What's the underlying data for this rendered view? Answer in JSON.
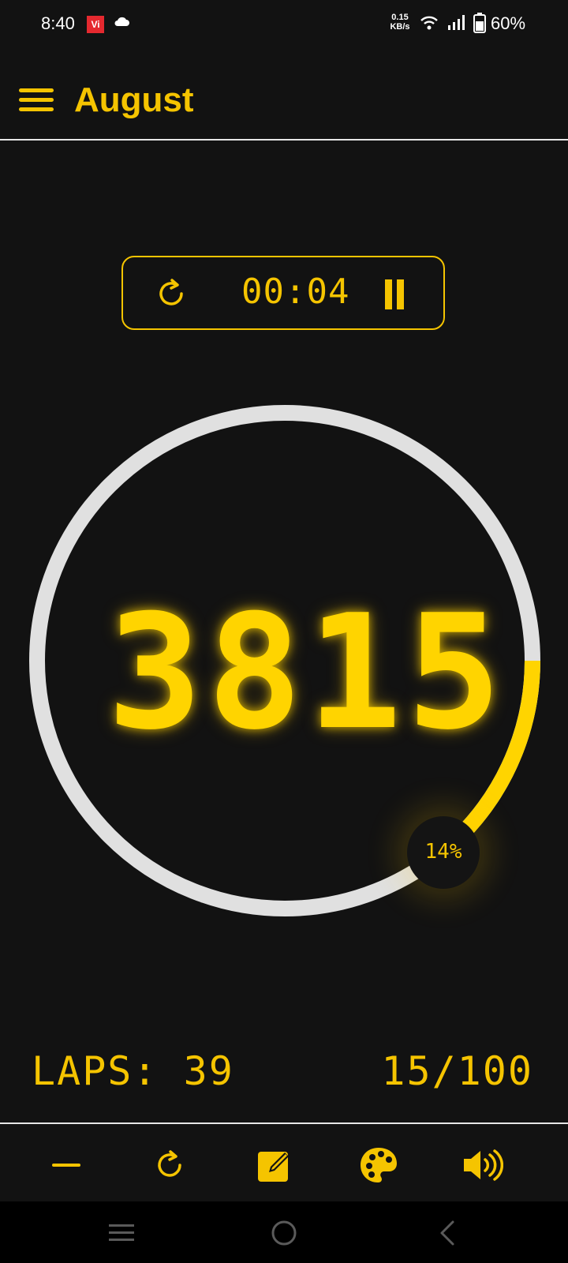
{
  "status_bar": {
    "time": "8:40",
    "carrier_badge": "Vi",
    "network_speed_value": "0.15",
    "network_speed_unit": "KB/s",
    "battery_percent": "60%"
  },
  "app_bar": {
    "title": "August"
  },
  "timer": {
    "value": "00:04"
  },
  "counter": {
    "count": "3815",
    "progress_percent": "14%",
    "progress_fraction": 0.14
  },
  "stats": {
    "laps": "LAPS: 39",
    "progress": "15/100"
  },
  "icons": {
    "menu": "hamburger-icon",
    "reset": "refresh-icon",
    "pause": "pause-icon",
    "minus": "minus-icon",
    "edit": "edit-icon",
    "palette": "palette-icon",
    "volume": "volume-icon"
  },
  "colors": {
    "accent": "#f5c400",
    "background": "#121212",
    "ring_track": "#e0e0e0"
  }
}
